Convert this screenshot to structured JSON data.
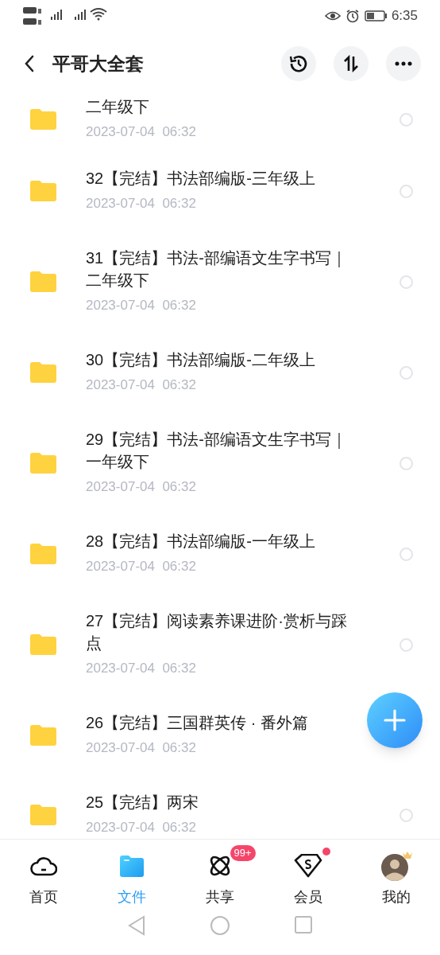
{
  "status_bar": {
    "time": "6:35"
  },
  "header": {
    "title": "平哥大全套"
  },
  "files": [
    {
      "title": "二年级下",
      "date": "2023-07-04  06:32",
      "selected": false
    },
    {
      "title": "32【完结】书法部编版-三年级上",
      "date": "2023-07-04  06:32",
      "selected": false
    },
    {
      "title": "31【完结】书法-部编语文生字书写｜二年级下",
      "date": "2023-07-04  06:32",
      "selected": false
    },
    {
      "title": "30【完结】书法部编版-二年级上",
      "date": "2023-07-04  06:32",
      "selected": false
    },
    {
      "title": "29【完结】书法-部编语文生字书写｜一年级下",
      "date": "2023-07-04  06:32",
      "selected": false
    },
    {
      "title": "28【完结】书法部编版-一年级上",
      "date": "2023-07-04  06:32",
      "selected": false
    },
    {
      "title": "27【完结】阅读素养课进阶·赏析与踩点",
      "date": "2023-07-04  06:32",
      "selected": false
    },
    {
      "title": "26【完结】三国群英传 · 番外篇",
      "date": "2023-07-04  06:32"
    },
    {
      "title": "25【完结】两宋",
      "date": "2023-07-04  06:32",
      "selected": false
    }
  ],
  "tab_bar": [
    {
      "kind": "home",
      "label": "首页",
      "selected": false
    },
    {
      "kind": "files",
      "label": "文件",
      "selected": true
    },
    {
      "kind": "share",
      "label": "共享",
      "selected": false,
      "badge": "99+"
    },
    {
      "kind": "vip",
      "label": "会员",
      "selected": false,
      "dot": true
    },
    {
      "kind": "profile",
      "label": "我的",
      "selected": false
    }
  ]
}
